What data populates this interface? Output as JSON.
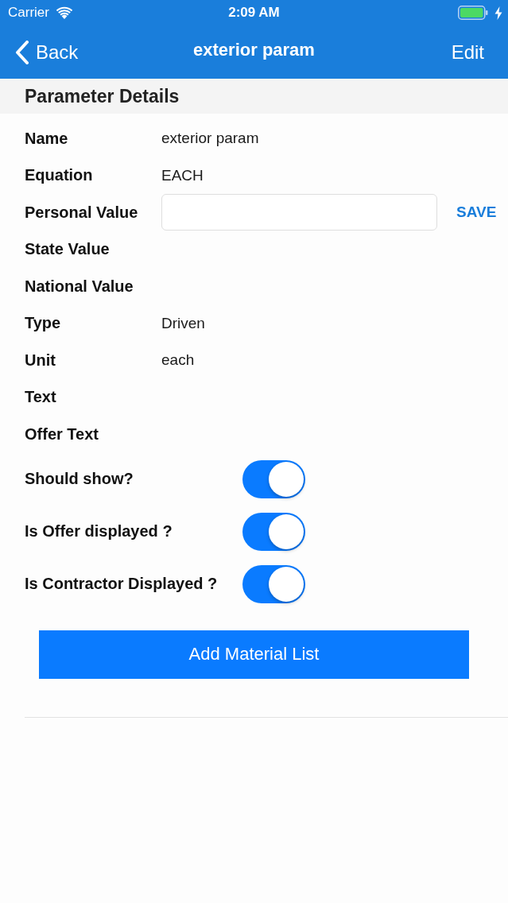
{
  "status_bar": {
    "carrier": "Carrier",
    "time": "2:09 AM",
    "charging": true
  },
  "nav_bar": {
    "back": "Back",
    "title": "exterior param",
    "action": "Edit"
  },
  "section": {
    "title": "Parameter Details"
  },
  "rows": [
    {
      "kind": "text",
      "label": "Name",
      "value": "exterior param"
    },
    {
      "kind": "text",
      "label": "Equation",
      "value": "EACH"
    },
    {
      "kind": "input",
      "label": "Personal Value",
      "action": "SAVE"
    },
    {
      "kind": "text",
      "label": "State Value"
    },
    {
      "kind": "text",
      "label": "National Value"
    },
    {
      "kind": "text",
      "label": "Type",
      "value": "Driven"
    },
    {
      "kind": "text",
      "label": "Unit",
      "value": "each"
    },
    {
      "kind": "text",
      "label": "Text"
    },
    {
      "kind": "text",
      "label": "Offer Text"
    }
  ],
  "toggles": [
    {
      "label": "Should show?",
      "on": true
    },
    {
      "label": "Is Offer displayed ?",
      "on": true
    },
    {
      "label": "Is Contractor Displayed ?",
      "on": true
    }
  ],
  "button": {
    "label": "Add Material List"
  }
}
